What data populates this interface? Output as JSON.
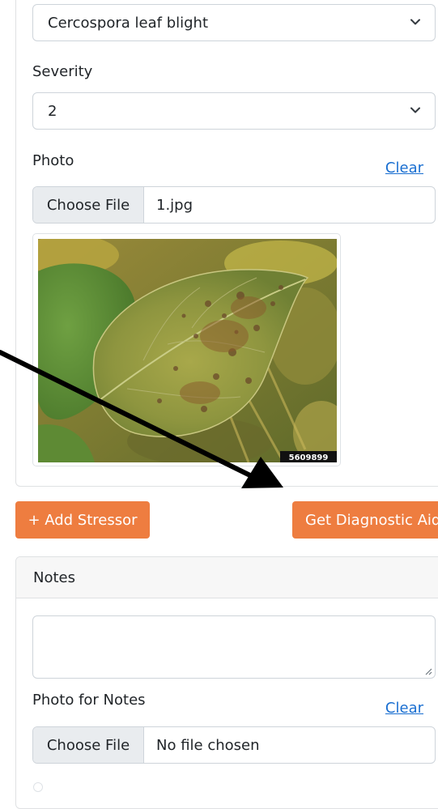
{
  "stressor": {
    "type_select": {
      "value": "Cercospora leaf blight"
    },
    "severity": {
      "label": "Severity",
      "value": "2"
    },
    "photo": {
      "label": "Photo",
      "clear_label": "Clear",
      "choose_file_label": "Choose File",
      "file_name": "1.jpg",
      "preview_watermark": "5609899"
    }
  },
  "actions": {
    "add_stressor_label": "+ Add Stressor",
    "diagnostic_label": "Get Diagnostic Aid"
  },
  "notes": {
    "header": "Notes",
    "textarea_value": "",
    "photo_label": "Photo for Notes",
    "clear_label": "Clear",
    "choose_file_label": "Choose File",
    "file_name": "No file chosen"
  },
  "colors": {
    "accent_button": "#ee7d40",
    "link": "#1a6fd1",
    "annotation_arrow": "#000000"
  }
}
